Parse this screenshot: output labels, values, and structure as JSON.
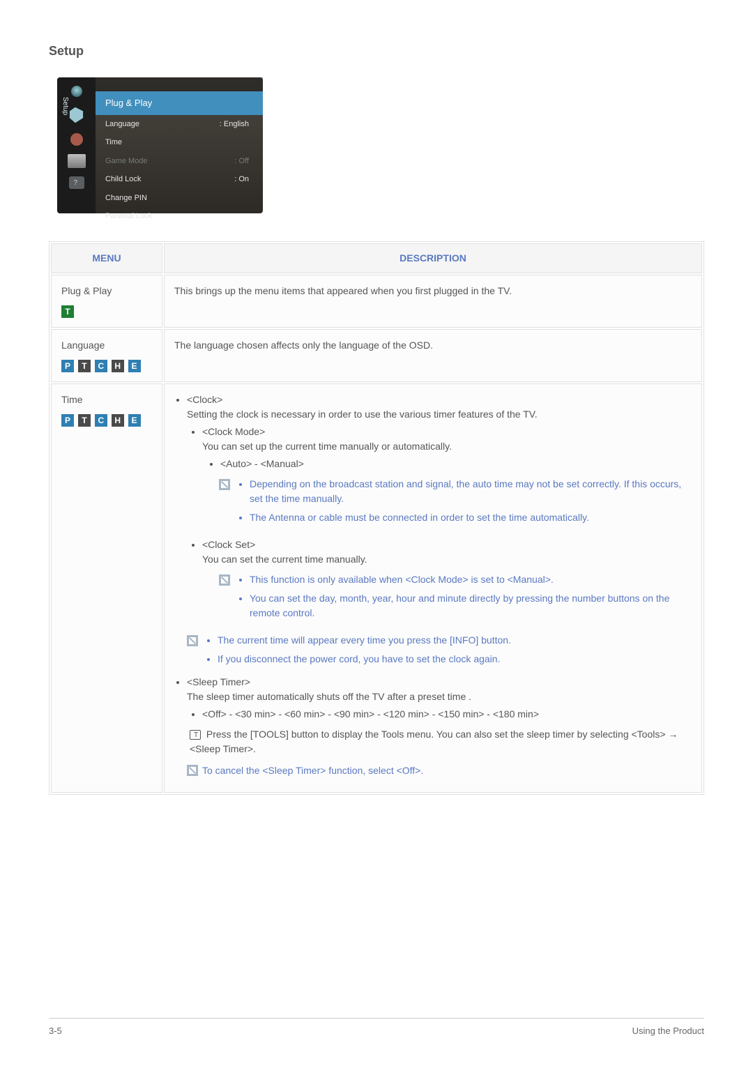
{
  "section": {
    "title": "Setup"
  },
  "setup_screenshot": {
    "sidebar_label": "Setup",
    "rows": [
      {
        "label": "Plug & Play",
        "value": "",
        "selected": true
      },
      {
        "label": "Language",
        "value": ": English"
      },
      {
        "label": "Time",
        "value": ""
      },
      {
        "label": "Game Mode",
        "value": ": Off",
        "dim": true
      },
      {
        "label": "Child Lock",
        "value": ": On"
      },
      {
        "label": "Change PIN",
        "value": ""
      },
      {
        "label": "Parental Lock",
        "value": ""
      }
    ]
  },
  "table": {
    "headers": {
      "menu": "MENU",
      "desc": "DESCRIPTION"
    },
    "rows": {
      "plug_play": {
        "title": "Plug & Play",
        "badges": "T",
        "desc": "This brings up the menu items that appeared when you first plugged in the TV."
      },
      "language": {
        "title": "Language",
        "desc": "The language chosen affects only the language of the OSD."
      },
      "time": {
        "title": "Time",
        "clock_hdr": "<Clock>",
        "clock_desc": "Setting the clock is necessary in order to use the various timer features of the TV.",
        "clock_mode_hdr": "<Clock Mode>",
        "clock_mode_desc": "You can set up the current time manually or automatically.",
        "clock_mode_vals": "<Auto> - <Manual>",
        "clock_mode_note1": "Depending on the broadcast station and signal, the auto time may not be set correctly. If this occurs, set the time manually.",
        "clock_mode_note2": "The Antenna or cable must be connected in order to set the time automatically.",
        "clock_set_hdr": "<Clock Set>",
        "clock_set_desc": "You can set the current time manually.",
        "clock_set_note1": "This function is only available when <Clock Mode> is set to <Manual>.",
        "clock_set_note2": "You can set the day, month, year, hour and minute directly by pressing the number buttons on the remote control.",
        "mid_note1": "The current time will appear every time you press the [INFO] button.",
        "mid_note2": "If you disconnect the power cord, you have to set the clock again.",
        "sleep_hdr": "<Sleep Timer>",
        "sleep_desc": "The sleep timer automatically shuts off the TV after a preset time .",
        "sleep_vals": "<Off> - <30 min> - <60 min> - <90 min> - <120 min> - <150 min> - <180 min>",
        "tools_note": "Press the [TOOLS] button to display the Tools menu. You can also set the sleep timer by selecting <Tools> → <Sleep Timer>.",
        "cancel_note": "To cancel the <Sleep Timer> function, select <Off>."
      }
    }
  },
  "footer": {
    "left": "3-5",
    "right": "Using the Product"
  }
}
